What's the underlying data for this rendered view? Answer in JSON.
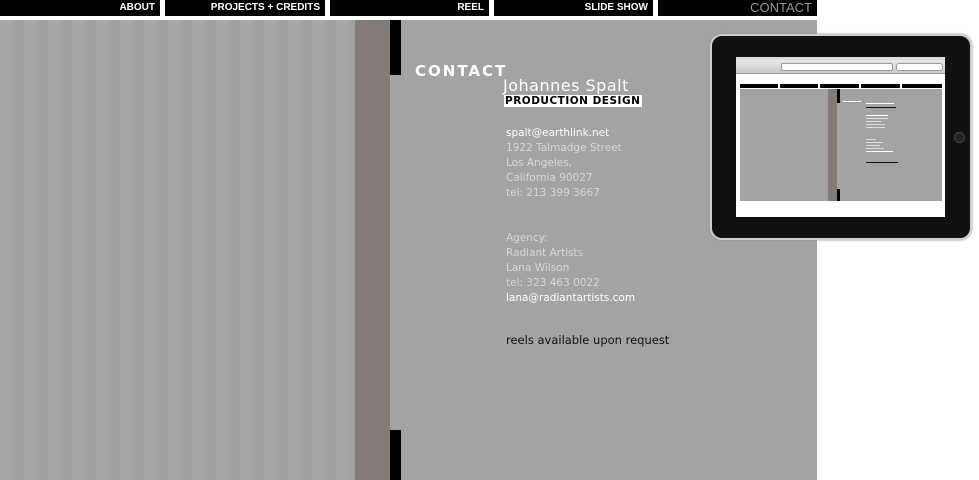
{
  "nav": {
    "items": [
      {
        "label": "ABOUT"
      },
      {
        "label": "PROJECTS + CREDITS"
      },
      {
        "label": "REEL"
      },
      {
        "label": "SLIDE SHOW"
      },
      {
        "label": "CONTACT"
      }
    ]
  },
  "contact": {
    "heading": "CONTACT",
    "name": "Johannes Spalt",
    "title": "PRODUCTION DESIGN",
    "email": "spalt@earthlink.net",
    "street": "1922 Talmadge Street",
    "city": "Los Angeles,",
    "state_zip": "California 90027",
    "phone": "tel: 213 399 3667"
  },
  "agency": {
    "label": "Agency:",
    "name": "Radiant Artists",
    "contact": "Lana Wilson",
    "phone": "tel: 323 463 0022",
    "email": "lana@radiantartists.com"
  },
  "reels_note": "reels available upon request",
  "colors": {
    "nav_bg": "#000000",
    "stage_bg": "#a3a3a3",
    "accent_taupe": "#847a77",
    "text_white": "#ffffff"
  }
}
